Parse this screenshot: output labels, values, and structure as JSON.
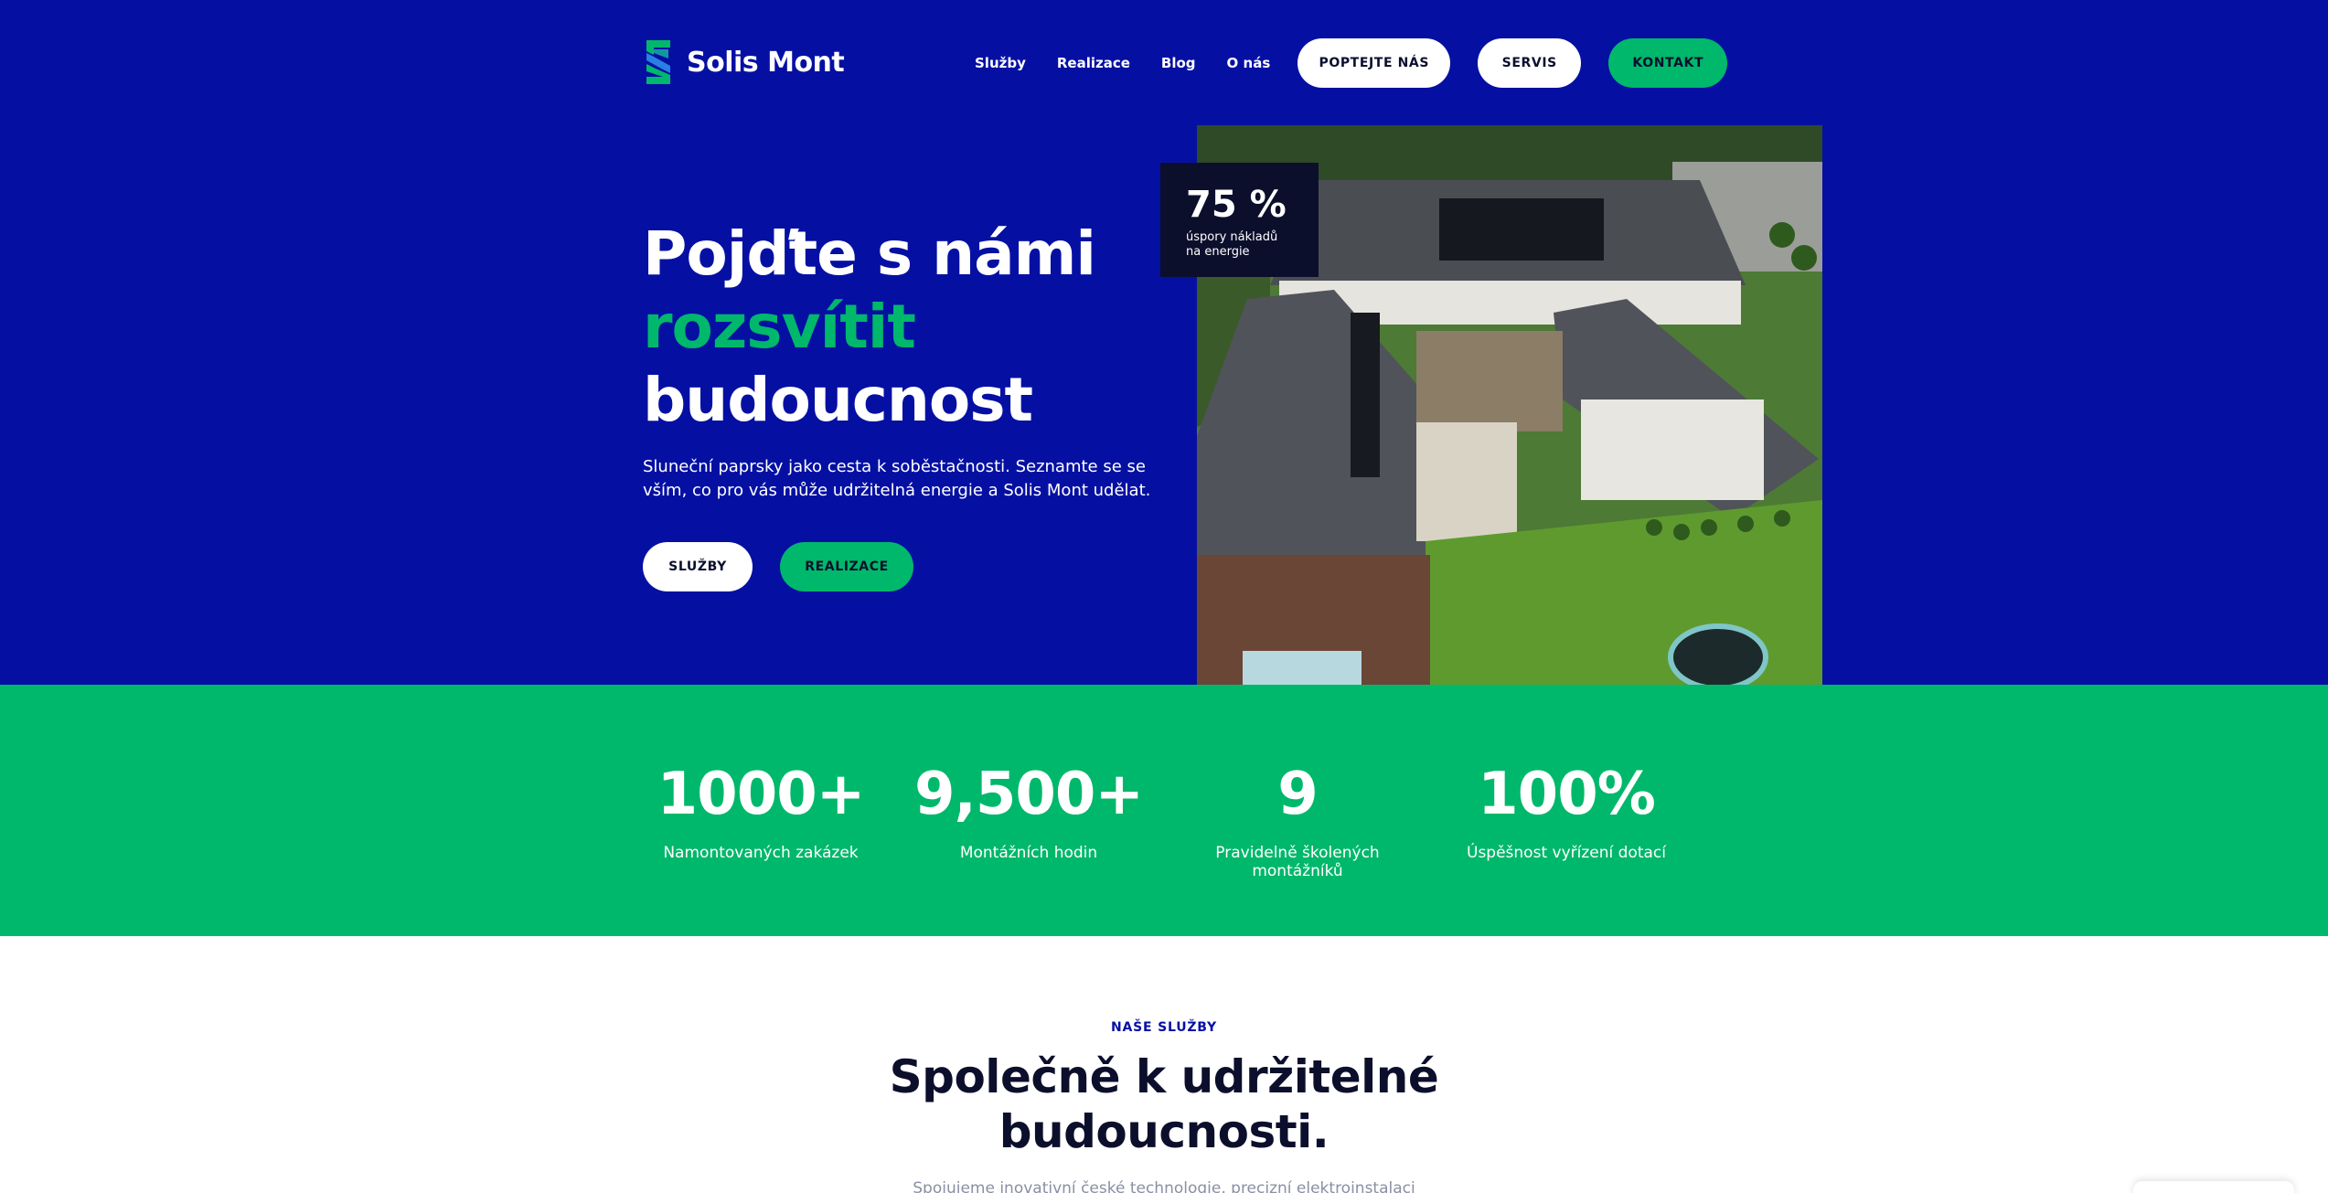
{
  "header": {
    "brand": "Solis Mont",
    "nav": [
      "Služby",
      "Realizace",
      "Blog",
      "O nás"
    ],
    "btn_quote": "POPTEJTE NÁS",
    "btn_servis": "SERVIS",
    "btn_contact": "KONTAKT"
  },
  "hero": {
    "line1": "Pojďte s námi",
    "line2": "rozsvítit",
    "line3": "budoucnost",
    "lead": "Sluneční paprsky jako cesta k soběstačnosti. Seznamte se se vším, co pro vás může udržitelná energie a Solis Mont udělat.",
    "btn_primary": "SLUŽBY",
    "btn_secondary": "REALIZACE",
    "badge_value": "75 %",
    "badge_label": "úspory nákladů na energie"
  },
  "stats": [
    {
      "value": "1000+",
      "label": "Namontovaných zakázek"
    },
    {
      "value": "9,500+",
      "label": "Montážních hodin"
    },
    {
      "value": "9",
      "label": "Pravidelně školených montážníků"
    },
    {
      "value": "100%",
      "label": "Úspěšnost vyřízení dotací"
    }
  ],
  "services": {
    "eyebrow": "NAŠE SLUŽBY",
    "title_line1": "Společně k udržitelné",
    "title_line2": "budoucnosti.",
    "subtitle": "Spojujeme inovativní české technologie, precizní elektroinstalaci"
  },
  "colors": {
    "primary_blue": "#0510a3",
    "accent_green": "#00b86b",
    "dark_navy": "#0c0f2c"
  }
}
